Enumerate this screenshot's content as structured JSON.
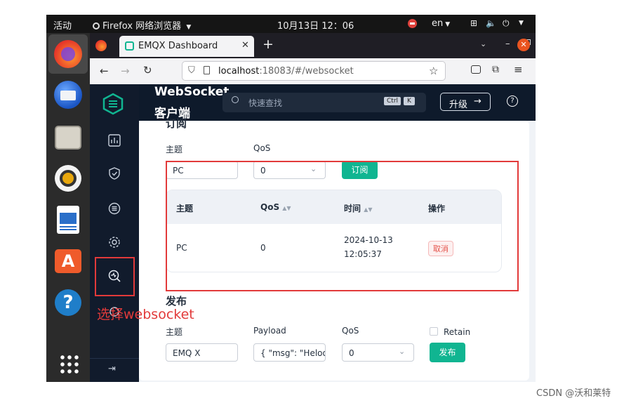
{
  "os_bar": {
    "activities": "活动",
    "app_menu": "Firefox 网络浏览器",
    "clock": "10月13日  12：06",
    "language": "en"
  },
  "browser": {
    "tab_title": "EMQX Dashboard",
    "url_host": "localhost",
    "url_rest": ":18083/#/websocket"
  },
  "header": {
    "title_line1": "WebSocket",
    "title_line2": "客户端",
    "search_placeholder": "快速查找",
    "kbd_ctrl": "Ctrl",
    "kbd_k": "K",
    "upgrade_label": "升级",
    "help_label": "?"
  },
  "subscribe": {
    "section_title": "订阅",
    "topic_label": "主题",
    "qos_label": "QoS",
    "topic_value": "PC",
    "qos_value": "0",
    "button_label": "订阅",
    "table": {
      "headers": [
        "主题",
        "QoS",
        "时间",
        "操作"
      ],
      "rows": [
        {
          "topic": "PC",
          "qos": "0",
          "time_date": "2024-10-13",
          "time_clock": "12:05:37",
          "action": "取消"
        }
      ]
    }
  },
  "publish": {
    "section_title": "发布",
    "topic_label": "主题",
    "payload_label": "Payload",
    "qos_label": "QoS",
    "retain_label": "Retain",
    "topic_value": "EMQ X",
    "payload_value": "{ \"msg\": \"Heloo",
    "qos_value": "0",
    "button_label": "发布"
  },
  "annotation": {
    "note": "选择websocket"
  },
  "watermark": "CSDN @沃和莱特",
  "colors": {
    "accent": "#10b591",
    "annotation_red": "#e23a3a",
    "sidebar_bg": "#111b2c",
    "firefox_orange": "#ff7139"
  }
}
